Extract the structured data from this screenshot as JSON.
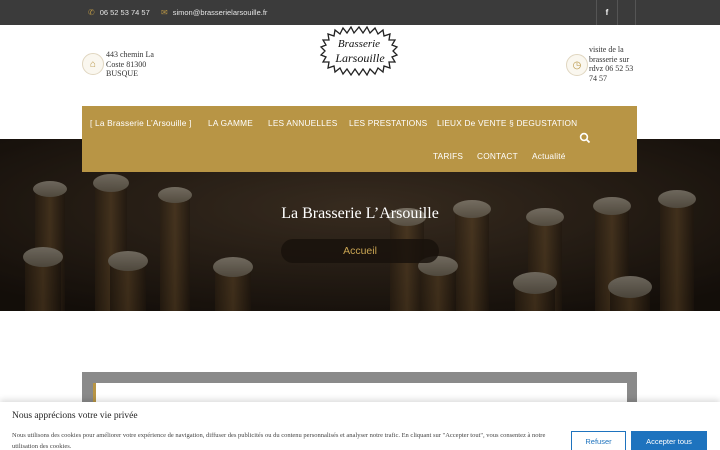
{
  "topbar": {
    "phone": "06 52 53 74 57",
    "email": "simon@brasserielarsouille.fr",
    "facebook_icon": "f"
  },
  "header": {
    "address": [
      "443 chemin La",
      "Coste 81300",
      "BUSQUE"
    ],
    "visit": [
      "visite de la",
      "brasserie sur",
      "rdvz 06 52 53",
      "74 57"
    ],
    "logo_line1": "Brasserie",
    "logo_line2": "Larsouille"
  },
  "nav": {
    "items": [
      "[ La Brasserie L’Arsouille ]",
      "LA GAMME",
      "LES ANNUELLES",
      "LES PRESTATIONS",
      "LIEUX De VENTE § DEGUSTATION",
      "TARIFS",
      "CONTACT",
      "Actualité"
    ]
  },
  "hero": {
    "title": "La Brasserie L’Arsouille",
    "breadcrumb": "Accueil"
  },
  "cookie": {
    "title": "Nous apprécions votre vie privée",
    "text": "Nous utilisons des cookies pour améliorer votre expérience de navigation, diffuser des publicités ou du contenu personnalisés et analyser notre trafic. En cliquant sur \"Accepter tout\", vous consentez à notre utilisation des cookies.",
    "refuse": "Refuser",
    "accept": "Accepter tous"
  },
  "colors": {
    "accent": "#b89545",
    "topbar": "#3b3b3b",
    "button_blue": "#1e73be"
  }
}
